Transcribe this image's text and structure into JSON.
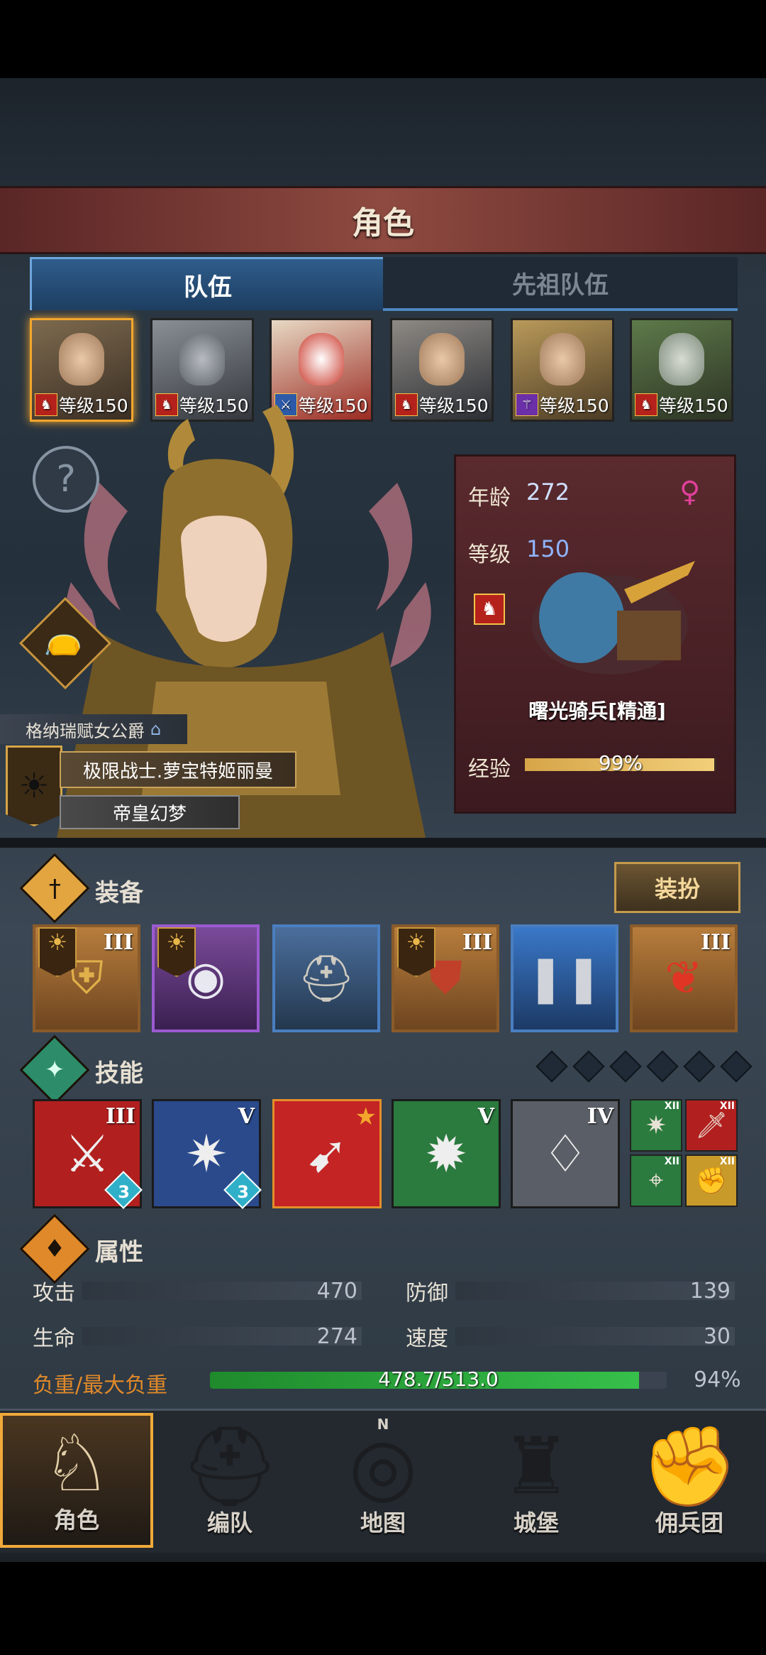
{
  "header": {
    "title": "角色"
  },
  "tabs": [
    {
      "label": "队伍"
    },
    {
      "label": "先祖队伍"
    }
  ],
  "team": [
    {
      "level": "等级150"
    },
    {
      "level": "等级150"
    },
    {
      "level": "等级150"
    },
    {
      "level": "等级150"
    },
    {
      "level": "等级150"
    },
    {
      "level": "等级150"
    }
  ],
  "character": {
    "title_tag": "格纳瑞赋女公爵",
    "name": "极限战士.萝宝特姬丽曼",
    "subtitle": "帝皇幻梦",
    "age_label": "年龄",
    "age": "272",
    "level_label": "等级",
    "level": "150",
    "unit": "曙光骑兵[精通]",
    "exp_label": "经验",
    "exp": "99%",
    "exp_fraction": 0.99
  },
  "equipment": {
    "title": "装备",
    "dress_button": "装扮",
    "slots": [
      {
        "icon": "shield-icon",
        "tier": "III"
      },
      {
        "icon": "round-shield-icon",
        "tier": ""
      },
      {
        "icon": "helmet-icon",
        "tier": ""
      },
      {
        "icon": "armor-icon",
        "tier": "III"
      },
      {
        "icon": "boots-icon",
        "tier": ""
      },
      {
        "icon": "emblem-icon",
        "tier": "III"
      }
    ]
  },
  "skills": {
    "title": "技能",
    "items": [
      {
        "tier": "III",
        "badge": "3"
      },
      {
        "tier": "V",
        "badge": "3"
      },
      {
        "tier": "",
        "badge": ""
      },
      {
        "tier": "V",
        "badge": ""
      },
      {
        "tier": "IV",
        "badge": ""
      }
    ],
    "small": [
      {
        "tier": "XII"
      },
      {
        "tier": "XII"
      },
      {
        "tier": "XII"
      },
      {
        "tier": "XII"
      }
    ]
  },
  "attributes": {
    "title": "属性",
    "attack_label": "攻击",
    "attack": "470",
    "defense_label": "防御",
    "defense": "139",
    "hp_label": "生命",
    "hp": "274",
    "speed_label": "速度",
    "speed": "30",
    "load_label": "负重/最大负重",
    "load": "478.7/513.0",
    "load_pct": "94%",
    "load_fraction": 0.94
  },
  "nav": [
    {
      "label": "角色"
    },
    {
      "label": "编队"
    },
    {
      "label": "地图"
    },
    {
      "label": "城堡"
    },
    {
      "label": "佣兵团"
    }
  ],
  "compass_letter": "N",
  "colors": {
    "accent": "#f3a62c",
    "female": "#e0409a",
    "load_bar": "#2fae3c",
    "tab_blue": "#2f5d8c"
  }
}
